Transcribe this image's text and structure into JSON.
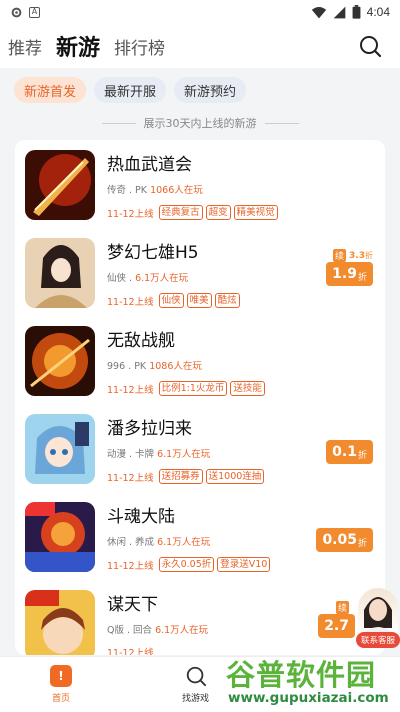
{
  "status_bar": {
    "time": "4:04",
    "icons": [
      "gear-icon",
      "a-box-icon",
      "wifi-icon",
      "signal-icon",
      "battery-icon"
    ]
  },
  "header": {
    "tabs": [
      {
        "label": "推荐",
        "active": false
      },
      {
        "label": "新游",
        "active": true
      },
      {
        "label": "排行榜",
        "active": false
      }
    ],
    "search_icon": "search-icon"
  },
  "filters": [
    {
      "label": "新游首发",
      "active": true
    },
    {
      "label": "最新开服",
      "active": false
    },
    {
      "label": "新游预约",
      "active": false
    }
  ],
  "section_heading": "展示30天内上线的新游",
  "games": [
    {
      "name": "热血武道会",
      "category": "传奇 . PK",
      "players": "1066人在玩",
      "date": "11-12上线",
      "tags": [
        "经典复古",
        "超变",
        "精美视觉"
      ],
      "discount": null
    },
    {
      "name": "梦幻七雄H5",
      "category": "仙侠 .",
      "players": "6.1万人在玩",
      "date": "11-12上线",
      "tags": [
        "仙侠",
        "唯美",
        "酷炫"
      ],
      "discount": {
        "xu": "续",
        "top": "3.3",
        "top_unit": "折",
        "value": "1.9",
        "unit": "折"
      }
    },
    {
      "name": "无敌战舰",
      "category": "996 . PK",
      "players": "1086人在玩",
      "date": "11-12上线",
      "tags": [
        "比例1:1火龙币",
        "送技能"
      ],
      "discount": null
    },
    {
      "name": "潘多拉归来",
      "category": "动漫 . 卡牌",
      "players": "6.1万人在玩",
      "date": "11-12上线",
      "tags": [
        "送招募券",
        "送1000连抽"
      ],
      "discount": {
        "value": "0.1",
        "unit": "折"
      }
    },
    {
      "name": "斗魂大陆",
      "category": "休闲 . 养成",
      "players": "6.1万人在玩",
      "date": "11-12上线",
      "tags": [
        "永久0.05折",
        "登录送V10"
      ],
      "discount": {
        "value": "0.05",
        "unit": "折"
      }
    },
    {
      "name": "谋天下",
      "category": "Q版 . 回合",
      "players": "6.1万人在玩",
      "date": "11-12上线",
      "tags": [],
      "discount": {
        "xu": "续",
        "top": "",
        "top_unit": "",
        "value": "2.7",
        "unit": ""
      }
    }
  ],
  "bottom_nav": [
    {
      "label": "首页",
      "icon": "home-icon",
      "active": true
    },
    {
      "label": "找游戏",
      "icon": "search-icon",
      "active": false
    }
  ],
  "support_label": "联系客服",
  "watermark": {
    "text": "谷普软件园",
    "url": "www.gupuxiazai.com"
  },
  "colors": {
    "accent": "#e8642a",
    "discount": "#f28a2e",
    "pill_active_bg": "#fde3d3"
  }
}
